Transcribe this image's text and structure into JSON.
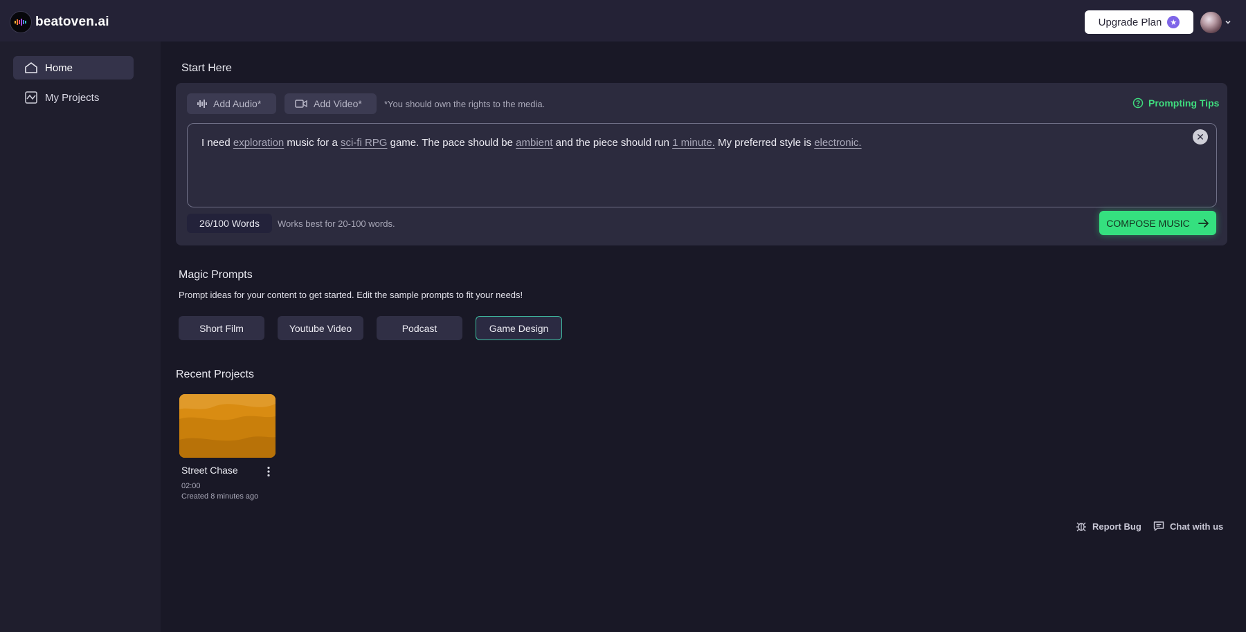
{
  "header": {
    "brand": "beatoven.ai",
    "upgrade_label": "Upgrade Plan"
  },
  "sidebar": {
    "items": [
      {
        "label": "Home",
        "icon": "home-icon",
        "active": true
      },
      {
        "label": "My Projects",
        "icon": "chart-line-icon",
        "active": false
      }
    ]
  },
  "start": {
    "title": "Start Here",
    "add_audio": "Add Audio*",
    "add_video": "Add Video*",
    "rights_note": "*You should own the rights to the media.",
    "tips_label": "Prompting Tips",
    "prompt": {
      "t1": "I need ",
      "k1": "exploration",
      "t2": " music for a ",
      "k2": "sci-fi RPG",
      "t3": " game. The pace should be ",
      "k3": "ambient",
      "t4": " and the piece should run ",
      "k4": "1 minute.",
      "t5": " My preferred style is ",
      "k5": "electronic."
    },
    "word_count": "26/100 Words",
    "word_hint": "Works best for 20-100 words.",
    "compose_label": "COMPOSE MUSIC"
  },
  "magic": {
    "title": "Magic Prompts",
    "subtitle": "Prompt ideas for your content to get started. Edit the sample prompts to fit your needs!",
    "chips": [
      "Short Film",
      "Youtube Video",
      "Podcast",
      "Game Design"
    ],
    "active_chip": "Game Design"
  },
  "recent": {
    "title": "Recent Projects",
    "projects": [
      {
        "title": "Street Chase",
        "duration": "02:00",
        "created": "Created 8 minutes ago"
      }
    ]
  },
  "footer": {
    "report_bug": "Report Bug",
    "chat": "Chat with us"
  },
  "colors": {
    "accent_green": "#35e07f",
    "tips_green": "#3fdc7e",
    "background": "#191826",
    "card": "#2c2b3e",
    "thumbnail": "#d4890f"
  }
}
